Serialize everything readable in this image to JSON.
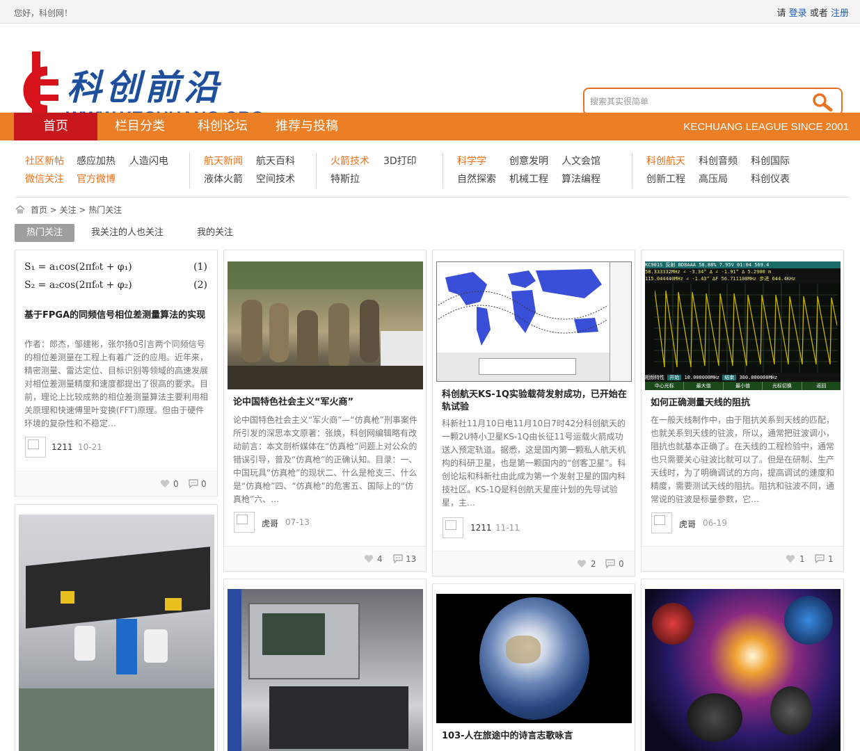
{
  "topbar": {
    "greeting": "您好，科创网！",
    "please": "请",
    "login": "登录",
    "or": "或者",
    "register": "注册"
  },
  "brand": {
    "name_cn": "科创前沿",
    "url": "WWW.KECHUANG.ORG"
  },
  "search": {
    "placeholder": "搜索其实很简单"
  },
  "nav": {
    "items": [
      "首页",
      "栏目分类",
      "科创论坛",
      "推荐与投稿"
    ],
    "slogan": "KECHUANG LEAGUE   SINCE 2001"
  },
  "subnav": {
    "groups": [
      [
        "社区新帖",
        "感应加热",
        "人造闪电",
        "微信关注",
        "官方微博"
      ],
      [
        "航天新闻",
        "航天百科",
        "液体火箭",
        "空间技术"
      ],
      [
        "火箭技术",
        "3D打印",
        "特斯拉"
      ],
      [
        "科学学",
        "创意发明",
        "人文会馆",
        "自然探索",
        "机械工程",
        "算法编程"
      ],
      [
        "科创航天",
        "科创音频",
        "科创国际",
        "创新工程",
        "高压局",
        "科创仪表"
      ]
    ]
  },
  "breadcrumb": {
    "home": "首页",
    "sep": ">",
    "level1": "关注",
    "level2": "热门关注"
  },
  "tabs": [
    "热门关注",
    "我关注的人也关注",
    "我的关注"
  ],
  "cards": [
    {
      "title": "基于FPGA的同频信号相位差测量算法的实现",
      "desc": "作者：郎杰，邹建彬，张尔扬0引言两个同频信号的相位差测量在工程上有着广泛的应用。近年来，精密测量、雷达定位、目标识别等领域的高速发展对相位差测量精度和速度都提出了很高的要求。目前，理论上比较成熟的相位差测量算法主要利用相关原理和快速傅里叶变换(FFT)原理。但由于硬件环境的复杂性和不稳定…",
      "user": "1211",
      "date": "10-21",
      "likes": "0",
      "comments": "0",
      "formula1": "S₁ = a₁cos(2πf₀t + φ₁)",
      "formula1_no": "(1)",
      "formula2": "S₂ = a₂cos(2πf₀t + φ₂)",
      "formula2_no": "(2)"
    },
    {
      "title": "论中国特色社会主义“军火商”",
      "desc": "论中国特色社会主义“军火商”—“仿真枪”刑事案件所引发的深思本文原著：张焕，科创网编辑略有改动前言：本文剖析媒体在“仿真枪”问题上对公众的错误引导，普及“仿真枪”的正确认知。目录：一、中国玩具“仿真枪”的现状二、什么是枪支三、什么是“仿真枪”四、“仿真枪”的危害五、国际上的“仿真枪”六、…",
      "user": "虎哥",
      "date": "07-13",
      "likes": "4",
      "comments": "13"
    },
    {
      "title": "科创航天KS-1Q实验载荷发射成功，已开始在轨试验",
      "desc": "科新社11月10日电11月10日7时42分科创航天的一颗2U特小卫星KS-1Q由长征11号运载火箭成功送入预定轨道。据悉，这是国内第一颗私人航天机构的科研卫星，也是第一颗国内的“创客卫星”。科创论坛和科新社由此成为第一个发射卫星的国内科技社区。KS-1Q是科创航天星座计划的先导试验星，主…",
      "user": "1211",
      "date": "11-11",
      "likes": "2",
      "comments": "0"
    },
    {
      "title": "如何正确测量天线的阻抗",
      "desc": "在一般天线制作中，由于阻抗关系到天线的匹配，也就关系到天线的驻波，所以，通常把驻波调小，阻抗也就基本正确了。在天线的工程检验中，通常也只需要关心驻波比就可以了。但是在研制、生产天线时，为了明确调试的方向，提高调试的速度和精度，需要测试天线的阻抗。阻抗和驻波不同，通常说的驻波是标量参数，它…",
      "user": "虎哥",
      "date": "06-19",
      "likes": "1",
      "comments": "1",
      "scope_header": "KC901S   反射   BD8AAA   58.88%  7.95V  01:04   569.4",
      "scope_line1": "58.333332MHz ∠  -3.34° ∆ ∠  -1.91° ∆ 5.2900 m",
      "scope_line2": "115.044440MHz ∠  -1.43° ∆F  56.711108MHz 步进 644.4KHz",
      "scope_start": "10.000000MHz",
      "scope_sep": "结束",
      "scope_end": "300.000000MHz",
      "scope_btns": [
        "中心光标",
        "最大值",
        "最小值",
        "光标切换",
        "返回"
      ],
      "scope_prop": "相频特性",
      "scope_start_lbl": "开始"
    },
    {
      "title": "103-人在旅途中的诗言志歌咏言"
    }
  ]
}
